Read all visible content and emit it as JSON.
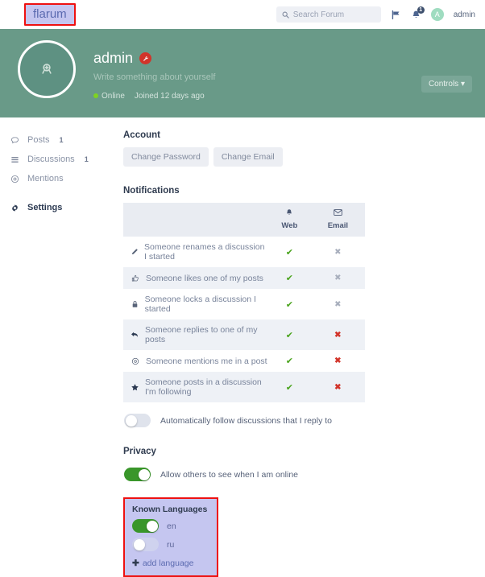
{
  "header": {
    "logo": "flarum",
    "search": {
      "placeholder": "Search Forum",
      "icon": "search-icon",
      "value": ""
    },
    "flag_icon": "flag-icon",
    "notifications": {
      "icon": "bell-icon",
      "badge_count": "1"
    },
    "user": {
      "avatar_initial": "A",
      "name": "admin"
    }
  },
  "hero": {
    "avatar_icon": "camera-upload-icon",
    "username": "admin",
    "badge_icon": "wrench-icon",
    "bio_placeholder": "Write something about yourself",
    "status": "Online",
    "joined": "Joined 12 days ago",
    "controls_label": "Controls",
    "controls_caret": "▾",
    "background_color": "#699a88"
  },
  "sidebar": {
    "items": [
      {
        "label": "Posts",
        "count": "1",
        "icon": "comment-icon",
        "active": false
      },
      {
        "label": "Discussions",
        "count": "1",
        "icon": "list-icon",
        "active": false
      },
      {
        "label": "Mentions",
        "count": "",
        "icon": "at-mention-icon",
        "active": false
      },
      {
        "label": "Settings",
        "count": "",
        "icon": "gear-icon",
        "active": true
      }
    ]
  },
  "account": {
    "title": "Account",
    "change_password_label": "Change Password",
    "change_email_label": "Change Email"
  },
  "notifications": {
    "title": "Notifications",
    "columns": [
      {
        "label": "",
        "icon": ""
      },
      {
        "label": "Web",
        "icon": "bell-icon"
      },
      {
        "label": "Email",
        "icon": "envelope-icon"
      }
    ],
    "rows": [
      {
        "icon": "pencil-icon",
        "label": "Someone renames a discussion I started",
        "web": "✔",
        "email": "✖",
        "email_state": "off"
      },
      {
        "icon": "thumbs-up-icon",
        "label": "Someone likes one of my posts",
        "web": "✔",
        "email": "✖",
        "email_state": "off"
      },
      {
        "icon": "lock-icon",
        "label": "Someone locks a discussion I started",
        "web": "✔",
        "email": "✖",
        "email_state": "off"
      },
      {
        "icon": "reply-icon",
        "label": "Someone replies to one of my posts",
        "web": "✔",
        "email": "✖",
        "email_state": "on"
      },
      {
        "icon": "at-mention-icon",
        "label": "Someone mentions me in a post",
        "web": "✔",
        "email": "✖",
        "email_state": "on"
      },
      {
        "icon": "star-icon",
        "label": "Someone posts in a discussion I'm following",
        "web": "✔",
        "email": "✖",
        "email_state": "on"
      }
    ],
    "follow_toggle": {
      "label": "Automatically follow discussions that I reply to",
      "state": "off"
    }
  },
  "privacy": {
    "title": "Privacy",
    "online_toggle": {
      "label": "Allow others to see when I am online",
      "state": "on"
    }
  },
  "known_languages": {
    "title": "Known Languages",
    "languages": [
      {
        "code": "en",
        "state": "on"
      },
      {
        "code": "ru",
        "state": "off"
      }
    ],
    "add_label": "add language",
    "add_icon": "plus-icon",
    "highlight_border_color": "#ee1111",
    "highlight_background_color": "#c5c6f0"
  },
  "colors": {
    "hero_green": "#699a88",
    "toggle_on_green": "#39962a",
    "check_green": "#49a31c",
    "x_red": "#d2342a",
    "x_gray": "#a8afbd",
    "highlight_lavender": "#c5c6f0",
    "highlight_red": "#ee1111"
  }
}
